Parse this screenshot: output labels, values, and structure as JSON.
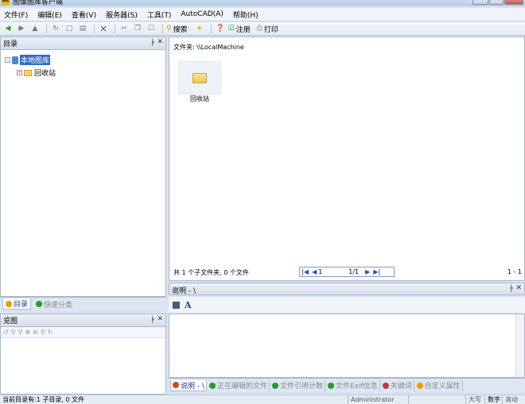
{
  "window": {
    "title": "图像图库客户端"
  },
  "menubar": [
    "文件(F)",
    "编辑(E)",
    "查看(V)",
    "服务器(S)",
    "工具(T)",
    "AutoCAD(A)",
    "帮助(H)"
  ],
  "toolbar": {
    "search_label": "搜索",
    "register_label": "注册",
    "print_label": "打印"
  },
  "directory_panel": {
    "title": "目录",
    "tree": [
      {
        "label": "本地图库",
        "selected": true
      },
      {
        "label": "回收站",
        "selected": false
      }
    ]
  },
  "left_tabs": [
    {
      "label": "目录",
      "active": true
    },
    {
      "label": "快速分类",
      "active": false
    }
  ],
  "preview_panel": {
    "title": "览图"
  },
  "main": {
    "path_label": "文件夹: \\\\LocalMachine",
    "items": [
      {
        "label": "回收站"
      }
    ],
    "summary": "共 1 个子文件夹, 0 个文件",
    "pager": {
      "current": "1",
      "pages": "1/1"
    },
    "page_range": "1 - 1"
  },
  "description_panel": {
    "title": "说明 - \\"
  },
  "bottom_tabs": [
    {
      "label": "说明 - \\",
      "active": true
    },
    {
      "label": "正在编辑的文件",
      "active": false
    },
    {
      "label": "文件引用计数",
      "active": false
    },
    {
      "label": "文件Exif信息",
      "active": false
    },
    {
      "label": "关键词",
      "active": false
    },
    {
      "label": "自定义属性",
      "active": false
    }
  ],
  "status": {
    "message": "当前目录有:1 子目录, 0 文件",
    "user": "Administrator",
    "caps": "大写",
    "num": "数字",
    "scroll": "滚动"
  }
}
